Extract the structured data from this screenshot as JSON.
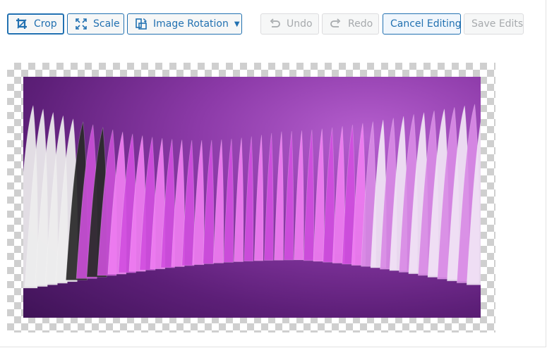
{
  "toolbar": {
    "crop_label": "Crop",
    "scale_label": "Scale",
    "rotation_label": "Image Rotation",
    "undo_label": "Undo",
    "redo_label": "Redo",
    "cancel_label": "Cancel Editing",
    "save_label": "Save Edits"
  },
  "icons": {
    "crop": "crop-icon",
    "scale": "scale-icon",
    "rotation": "rotate-icon",
    "caret": "caret-down-icon",
    "undo": "undo-icon",
    "redo": "redo-icon"
  },
  "colors": {
    "accent": "#2271b1",
    "disabled": "#a7aaad",
    "checker": "#cfcfcf"
  },
  "editor": {
    "image_alt": "Abstract purple wave image"
  }
}
